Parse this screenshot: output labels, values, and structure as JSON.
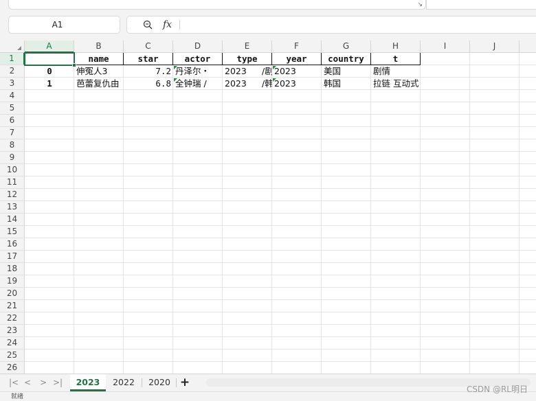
{
  "ribbon": {
    "expand_icon": "dialog-launcher-icon"
  },
  "formula_bar": {
    "name_box": "A1",
    "zoom_icon": "zoom-in-icon",
    "fx_label": "fx",
    "value": ""
  },
  "columns": [
    "A",
    "B",
    "C",
    "D",
    "E",
    "F",
    "G",
    "H",
    "I",
    "J"
  ],
  "rows": [
    "1",
    "2",
    "3",
    "4",
    "5",
    "6",
    "7",
    "8",
    "9",
    "10",
    "11",
    "12",
    "13",
    "14",
    "15",
    "16",
    "17",
    "18",
    "19",
    "20",
    "21",
    "22",
    "23",
    "24",
    "25",
    "26"
  ],
  "sheet": {
    "header_row": [
      "",
      "name",
      "star",
      "actor",
      "type",
      "year",
      "country",
      "t"
    ],
    "data_rows": [
      [
        "0",
        "伸冤人3",
        "7.2",
        "丹泽尔・",
        "2023",
        "/剧",
        "2023",
        "美国",
        "剧情"
      ],
      [
        "1",
        "芭蕾复仇由",
        "6.8",
        "全钟瑞 /",
        "2023",
        "/韩",
        "2023",
        "韩国",
        "拉链 互动式"
      ]
    ]
  },
  "tabs": {
    "nav": [
      "first-sheet-icon",
      "prev-sheet-icon",
      "next-sheet-icon",
      "last-sheet-icon"
    ],
    "sheets": [
      "2023",
      "2022",
      "2020"
    ],
    "active": "2023",
    "add_label": "+"
  },
  "status": {
    "text": "就绪"
  },
  "watermark": "CSDN @RL明日",
  "colors": {
    "accent": "#217346",
    "flag": "#1e8a3e",
    "grid": "#e4e4e4",
    "header_bg": "#f3f3f3"
  }
}
